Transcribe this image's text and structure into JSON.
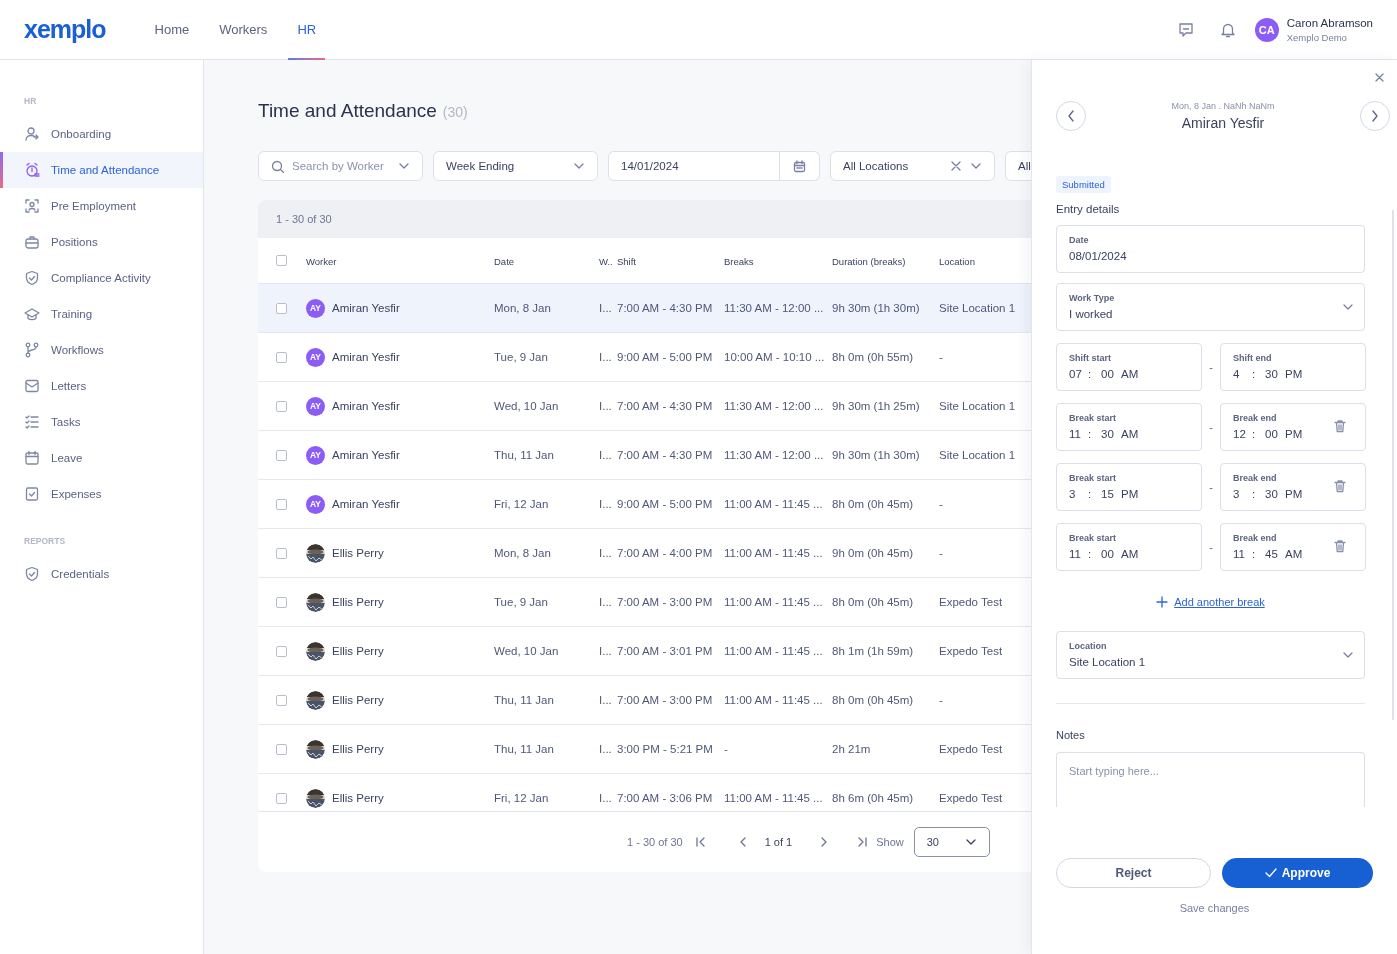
{
  "header": {
    "logo": "xemplo",
    "nav": [
      {
        "label": "Home",
        "selected": false
      },
      {
        "label": "Workers",
        "selected": false
      },
      {
        "label": "HR",
        "selected": true
      }
    ],
    "user": {
      "initials": "CA",
      "name": "Caron Abramson",
      "org": "Xemplo Demo"
    }
  },
  "sidebar": {
    "sections": [
      {
        "title": "HR",
        "items": [
          {
            "label": "Onboarding",
            "selected": false
          },
          {
            "label": "Time and Attendance",
            "selected": true
          },
          {
            "label": "Pre Employment",
            "selected": false
          },
          {
            "label": "Positions",
            "selected": false
          },
          {
            "label": "Compliance Activity",
            "selected": false
          },
          {
            "label": "Training",
            "selected": false
          },
          {
            "label": "Workflows",
            "selected": false
          },
          {
            "label": "Letters",
            "selected": false
          },
          {
            "label": "Tasks",
            "selected": false
          },
          {
            "label": "Leave",
            "selected": false
          },
          {
            "label": "Expenses",
            "selected": false
          }
        ]
      },
      {
        "title": "REPORTS",
        "items": [
          {
            "label": "Credentials",
            "selected": false
          }
        ]
      }
    ]
  },
  "page": {
    "title": "Time and Attendance",
    "count": "(30)",
    "filters": [
      {
        "kind": "search",
        "placeholder": "Search by Worker"
      },
      {
        "kind": "select",
        "value": "Week Ending"
      },
      {
        "kind": "date",
        "value": "14/01/2024"
      },
      {
        "kind": "clearable",
        "value": "All Locations"
      },
      {
        "kind": "select",
        "value": "All"
      }
    ],
    "table": {
      "range": "1 - 30 of 30",
      "all_checked": false,
      "columns": [
        "Worker",
        "Date",
        "W..",
        "Shift",
        "Breaks",
        "Duration (breaks)",
        "Location"
      ],
      "rows": [
        {
          "selected": true,
          "checked": false,
          "avatar": {
            "kind": "initials",
            "text": "AY"
          },
          "cells": [
            "Amiran Yesfir",
            "Mon, 8 Jan",
            "I...",
            "7:00 AM - 4:30 PM",
            "11:30 AM - 12:00 ...",
            "9h 30m (1h 30m)",
            "Site Location 1"
          ]
        },
        {
          "selected": false,
          "checked": false,
          "avatar": {
            "kind": "initials",
            "text": "AY"
          },
          "cells": [
            "Amiran Yesfir",
            "Tue, 9 Jan",
            "I...",
            "9:00 AM - 5:00 PM",
            "10:00 AM - 10:10 ...",
            "8h 0m (0h 55m)",
            "-"
          ]
        },
        {
          "selected": false,
          "checked": false,
          "avatar": {
            "kind": "initials",
            "text": "AY"
          },
          "cells": [
            "Amiran Yesfir",
            "Wed, 10 Jan",
            "I...",
            "7:00 AM - 4:30 PM",
            "11:30 AM - 12:00 ...",
            "9h 30m (1h 25m)",
            "Site Location 1"
          ]
        },
        {
          "selected": false,
          "checked": false,
          "avatar": {
            "kind": "initials",
            "text": "AY"
          },
          "cells": [
            "Amiran Yesfir",
            "Thu, 11 Jan",
            "I...",
            "7:00 AM - 4:30 PM",
            "11:30 AM - 12:00 ...",
            "9h 30m (1h 30m)",
            "Site Location 1"
          ]
        },
        {
          "selected": false,
          "checked": false,
          "avatar": {
            "kind": "initials",
            "text": "AY"
          },
          "cells": [
            "Amiran Yesfir",
            "Fri, 12 Jan",
            "I...",
            "9:00 AM - 5:00 PM",
            "11:00 AM - 11:45 ...",
            "8h 0m (0h 45m)",
            "-"
          ]
        },
        {
          "selected": false,
          "checked": false,
          "cells": [
            "Ellis Perry",
            "Mon, 8 Jan",
            "I...",
            "7:00 AM - 4:00 PM",
            "11:00 AM - 11:45 ...",
            "9h 0m (0h 45m)",
            "-"
          ]
        },
        {
          "selected": false,
          "checked": false,
          "cells": [
            "Ellis Perry",
            "Tue, 9 Jan",
            "I...",
            "7:00 AM - 3:00 PM",
            "11:00 AM - 11:45 ...",
            "8h 0m (0h 45m)",
            "Expedo Test"
          ]
        },
        {
          "selected": false,
          "checked": false,
          "cells": [
            "Ellis Perry",
            "Wed, 10 Jan",
            "I...",
            "7:00 AM - 3:01 PM",
            "11:00 AM - 11:45 ...",
            "8h 1m (1h 59m)",
            "Expedo Test"
          ]
        },
        {
          "selected": false,
          "checked": false,
          "cells": [
            "Ellis Perry",
            "Thu, 11 Jan",
            "I...",
            "7:00 AM - 3:00 PM",
            "11:00 AM - 11:45 ...",
            "8h 0m (0h 45m)",
            "-"
          ]
        },
        {
          "selected": false,
          "checked": false,
          "cells": [
            "Ellis Perry",
            "Thu, 11 Jan",
            "I...",
            "3:00 PM - 5:21 PM",
            "-",
            "2h 21m",
            "Expedo Test"
          ]
        },
        {
          "selected": false,
          "checked": false,
          "cells": [
            "Ellis Perry",
            "Fri, 12 Jan",
            "I...",
            "7:00 AM - 3:06 PM",
            "11:00 AM - 11:45 ...",
            "8h 6m (0h 45m)",
            "Expedo Test"
          ]
        }
      ],
      "pagination": {
        "range": "1 - 30 of 30",
        "page": "1 of 1",
        "show_label": "Show",
        "page_size": "30"
      }
    }
  },
  "panel": {
    "subtitle": "Mon, 8 Jan . NaNh NaNm",
    "name": "Amiran Yesfir",
    "status": "Submitted",
    "section": "Entry details",
    "date": {
      "label": "Date",
      "value": "08/01/2024"
    },
    "work_type": {
      "label": "Work Type",
      "value": "I worked"
    },
    "times": [
      {
        "kind": "shift",
        "start": {
          "label": "Shift start",
          "hour": "07",
          "minute": "00",
          "period": "AM"
        },
        "end": {
          "label": "Shift end",
          "hour": "4",
          "minute": "30",
          "period": "PM"
        }
      },
      {
        "kind": "break",
        "start": {
          "label": "Break start",
          "hour": "11",
          "minute": "30",
          "period": "AM"
        },
        "end": {
          "label": "Break end",
          "hour": "12",
          "minute": "00",
          "period": "PM"
        }
      },
      {
        "kind": "break",
        "start": {
          "label": "Break start",
          "hour": "3",
          "minute": "15",
          "period": "PM"
        },
        "end": {
          "label": "Break end",
          "hour": "3",
          "minute": "30",
          "period": "PM"
        }
      },
      {
        "kind": "break",
        "start": {
          "label": "Break start",
          "hour": "11",
          "minute": "00",
          "period": "AM"
        },
        "end": {
          "label": "Break end",
          "hour": "11",
          "minute": "45",
          "period": "AM"
        }
      }
    ],
    "separator": "-",
    "time_colon": ":",
    "add_break": "Add another break",
    "location": {
      "label": "Location",
      "value": "Site Location 1"
    },
    "notes": {
      "label": "Notes",
      "placeholder": "Start typing here..."
    },
    "buttons": [
      {
        "kind": "secondary",
        "label": "Reject"
      },
      {
        "kind": "primary",
        "label": "Approve"
      }
    ],
    "save": "Save changes"
  }
}
